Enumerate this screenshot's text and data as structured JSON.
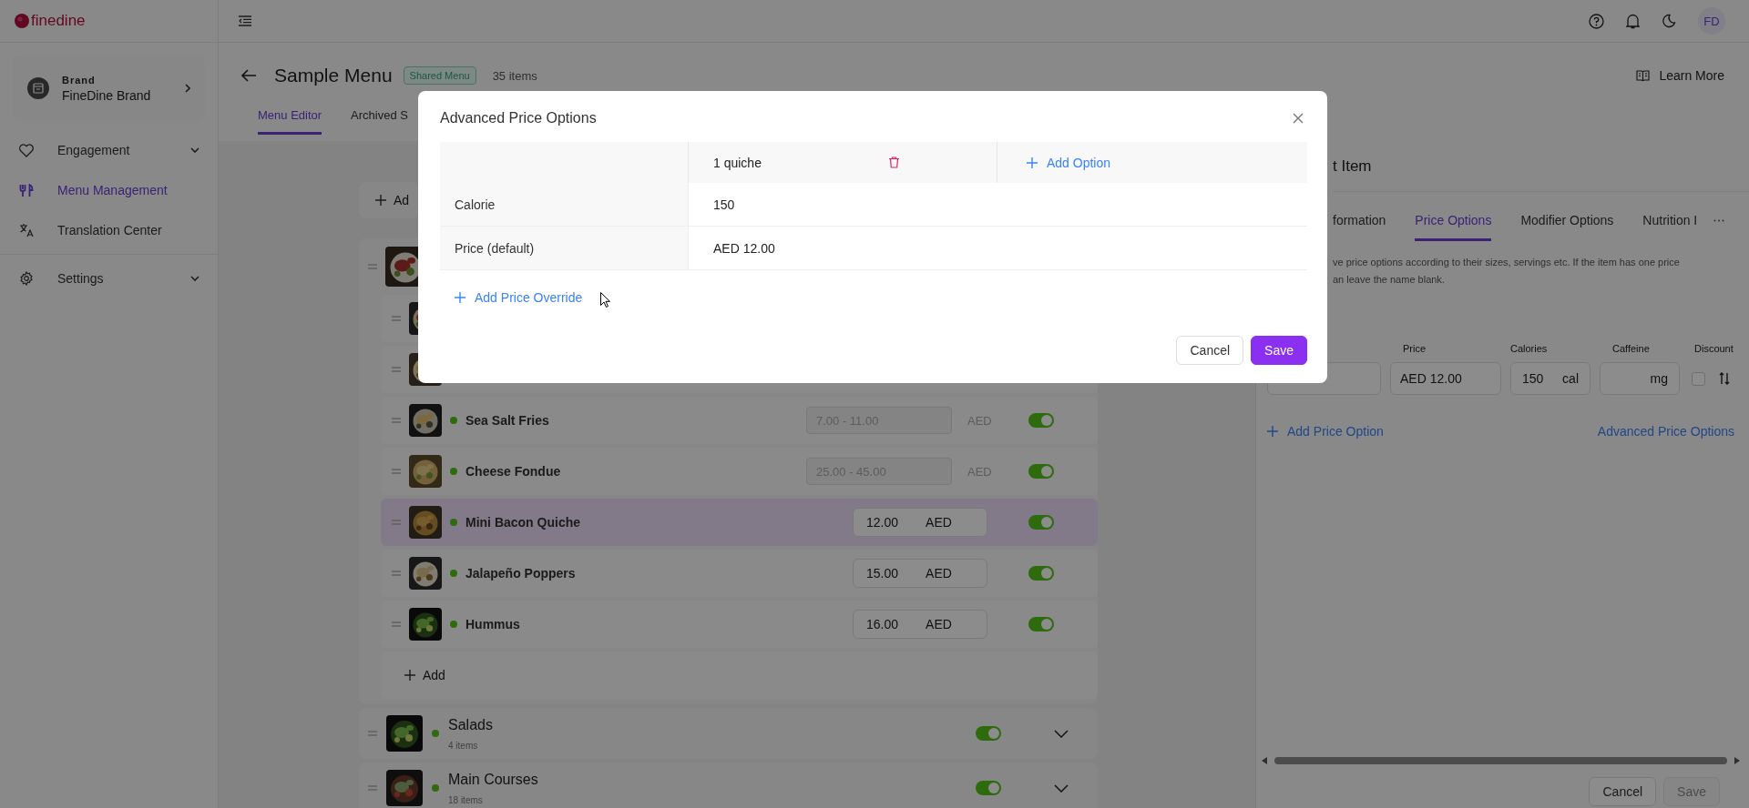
{
  "app": {
    "logo": "finedine",
    "avatar": "FD"
  },
  "brand": {
    "label": "Brand",
    "name": "FineDine Brand"
  },
  "nav": [
    {
      "label": "Engagement",
      "kind": "heart",
      "expandable": true,
      "selected": false
    },
    {
      "label": "Menu Management",
      "kind": "cutlery",
      "expandable": false,
      "selected": true
    },
    {
      "label": "Translation Center",
      "kind": "translate",
      "expandable": false,
      "selected": false
    },
    {
      "label": "Settings",
      "kind": "gear",
      "expandable": true,
      "selected": false
    }
  ],
  "page": {
    "title": "Sample Menu",
    "badge": "Shared Menu",
    "count": "35 items",
    "learn_more": "Learn More",
    "add_label": "Ad",
    "tabs": [
      {
        "label": "Menu Editor",
        "selected": true
      },
      {
        "label": "Archived S",
        "selected": false
      }
    ]
  },
  "items": [
    {
      "kind": "covered"
    },
    {
      "kind": "covered"
    },
    {
      "kind": "range",
      "name": "Sea Salt Fries",
      "active": true,
      "price": "7.00 - 11.00",
      "currency": "AED",
      "on": true,
      "selected": false
    },
    {
      "kind": "range",
      "name": "Cheese Fondue",
      "active": true,
      "price": "25.00 - 45.00",
      "currency": "AED",
      "on": true,
      "selected": false
    },
    {
      "kind": "single",
      "name": "Mini Bacon Quiche",
      "active": true,
      "price": "12.00",
      "currency": "AED",
      "on": true,
      "selected": true
    },
    {
      "kind": "single",
      "name": "Jalapeño Poppers",
      "active": true,
      "price": "15.00",
      "currency": "AED",
      "on": true,
      "selected": false
    },
    {
      "kind": "single",
      "name": "Hummus",
      "active": true,
      "price": "16.00",
      "currency": "AED",
      "on": true,
      "selected": false
    }
  ],
  "add_item": "Add",
  "categories": [
    {
      "name": "Salads",
      "count": "4 items",
      "active": true,
      "on": true
    },
    {
      "name": "Main Courses",
      "count": "18 items",
      "active": true,
      "on": true
    }
  ],
  "panel": {
    "title": "t Item",
    "tabs": [
      {
        "label": "formation",
        "selected": false
      },
      {
        "label": "Price Options",
        "selected": true
      },
      {
        "label": "Modifier Options",
        "selected": false
      },
      {
        "label": "Nutrition I",
        "selected": false
      }
    ],
    "description_lines": [
      "ve price options according to their sizes, servings etc. If the item has one price",
      "an leave the name blank."
    ],
    "columns": [
      "Price",
      "Calories",
      "Caffeine",
      "Discount"
    ],
    "option": {
      "price": "AED 12.00",
      "calories": "150",
      "calories_unit": "cal",
      "caffeine_unit": "mg",
      "discount": false
    },
    "add_option": "Add Price Option",
    "advanced": "Advanced Price Options",
    "cancel": "Cancel",
    "save": "Save",
    "save_disabled": true
  },
  "modal": {
    "title": "Advanced Price Options",
    "options": [
      "1 quiche"
    ],
    "add_option": "Add Option",
    "rows": [
      {
        "label": "Calorie",
        "values": [
          "150"
        ]
      },
      {
        "label": "Price (default)",
        "values": [
          "AED 12.00"
        ]
      }
    ],
    "add_override": "Add Price Override",
    "cancel": "Cancel",
    "save": "Save"
  }
}
